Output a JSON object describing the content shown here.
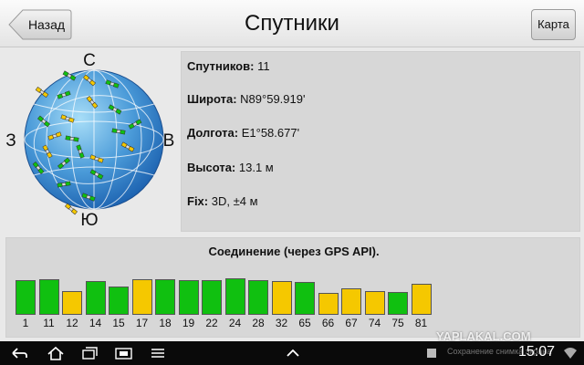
{
  "header": {
    "back_label": "Назад",
    "title": "Спутники",
    "map_label": "Карта"
  },
  "compass": {
    "north": "С",
    "south": "Ю",
    "west": "З",
    "east": "В"
  },
  "info": {
    "satellites_label": "Спутников:",
    "satellites_value": "11",
    "latitude_label": "Широта:",
    "latitude_value": "N89°59.919'",
    "longitude_label": "Долгота:",
    "longitude_value": "E1°58.677'",
    "altitude_label": "Высота:",
    "altitude_value": "13.1 м",
    "fix_label": "Fix:",
    "fix_value": "3D, ±4 м"
  },
  "connection": {
    "title": "Соединение (через GPS API).",
    "satellites": [
      {
        "id": "1",
        "level": 0.85,
        "status": "used"
      },
      {
        "id": "11",
        "level": 0.87,
        "status": "used"
      },
      {
        "id": "12",
        "level": 0.57,
        "status": "tracked"
      },
      {
        "id": "14",
        "level": 0.82,
        "status": "used"
      },
      {
        "id": "15",
        "level": 0.68,
        "status": "used"
      },
      {
        "id": "17",
        "level": 0.87,
        "status": "tracked"
      },
      {
        "id": "18",
        "level": 0.87,
        "status": "used"
      },
      {
        "id": "19",
        "level": 0.85,
        "status": "used"
      },
      {
        "id": "22",
        "level": 0.85,
        "status": "used"
      },
      {
        "id": "24",
        "level": 0.89,
        "status": "used"
      },
      {
        "id": "28",
        "level": 0.85,
        "status": "used"
      },
      {
        "id": "32",
        "level": 0.82,
        "status": "tracked"
      },
      {
        "id": "65",
        "level": 0.8,
        "status": "used"
      },
      {
        "id": "66",
        "level": 0.53,
        "status": "tracked"
      },
      {
        "id": "67",
        "level": 0.64,
        "status": "tracked"
      },
      {
        "id": "74",
        "level": 0.57,
        "status": "tracked"
      },
      {
        "id": "75",
        "level": 0.55,
        "status": "used"
      },
      {
        "id": "81",
        "level": 0.75,
        "status": "tracked"
      }
    ]
  },
  "colors": {
    "used": "#10c010",
    "tracked": "#f5c800",
    "globe_light": "#8fd0f5",
    "globe_dark": "#1a5fae"
  },
  "system_bar": {
    "clock": "15:07",
    "watermark": "YAPLAKAL.COM",
    "watermark_sub": "Сохранение снимка экрана"
  }
}
